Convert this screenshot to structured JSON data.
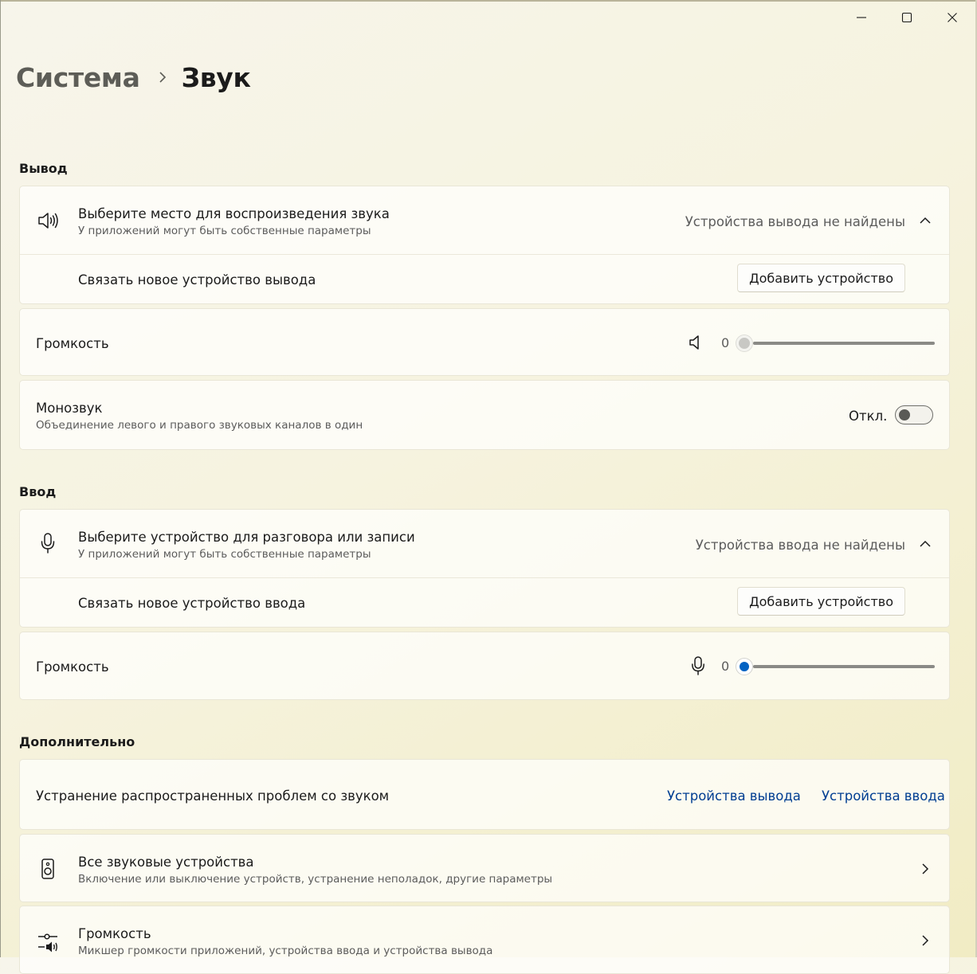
{
  "window": {
    "controls": {
      "minimize": "minimize",
      "maximize": "maximize",
      "close": "close"
    }
  },
  "breadcrumb": {
    "parent": "Система",
    "current": "Звук"
  },
  "output": {
    "header": "Вывод",
    "device_select": {
      "title": "Выберите место для воспроизведения звука",
      "subtitle": "У приложений могут быть собственные параметры",
      "status": "Устройства вывода не найдены"
    },
    "pair": {
      "label": "Связать новое устройство вывода",
      "button": "Добавить устройство"
    },
    "volume": {
      "label": "Громкость",
      "value": "0",
      "level": 0
    },
    "mono": {
      "title": "Монозвук",
      "subtitle": "Объединение левого и правого звуковых каналов в один",
      "state": "Откл.",
      "on": false
    }
  },
  "input": {
    "header": "Ввод",
    "device_select": {
      "title": "Выберите устройство для разговора или записи",
      "subtitle": "У приложений могут быть собственные параметры",
      "status": "Устройства ввода не найдены"
    },
    "pair": {
      "label": "Связать новое устройство ввода",
      "button": "Добавить устройство"
    },
    "volume": {
      "label": "Громкость",
      "value": "0",
      "level": 0
    }
  },
  "advanced": {
    "header": "Дополнительно",
    "troubleshoot": {
      "label": "Устранение распространенных проблем со звуком",
      "link_output": "Устройства вывода",
      "link_input": "Устройства ввода"
    },
    "all_devices": {
      "title": "Все звуковые устройства",
      "subtitle": "Включение или выключение устройств, устранение неполадок, другие параметры"
    },
    "volume_mixer": {
      "title": "Громкость",
      "subtitle": "Микшер громкости приложений, устройства ввода и устройства вывода"
    }
  },
  "colors": {
    "accent": "#0061c2",
    "link": "#003e92",
    "background": "#f6f3df"
  }
}
